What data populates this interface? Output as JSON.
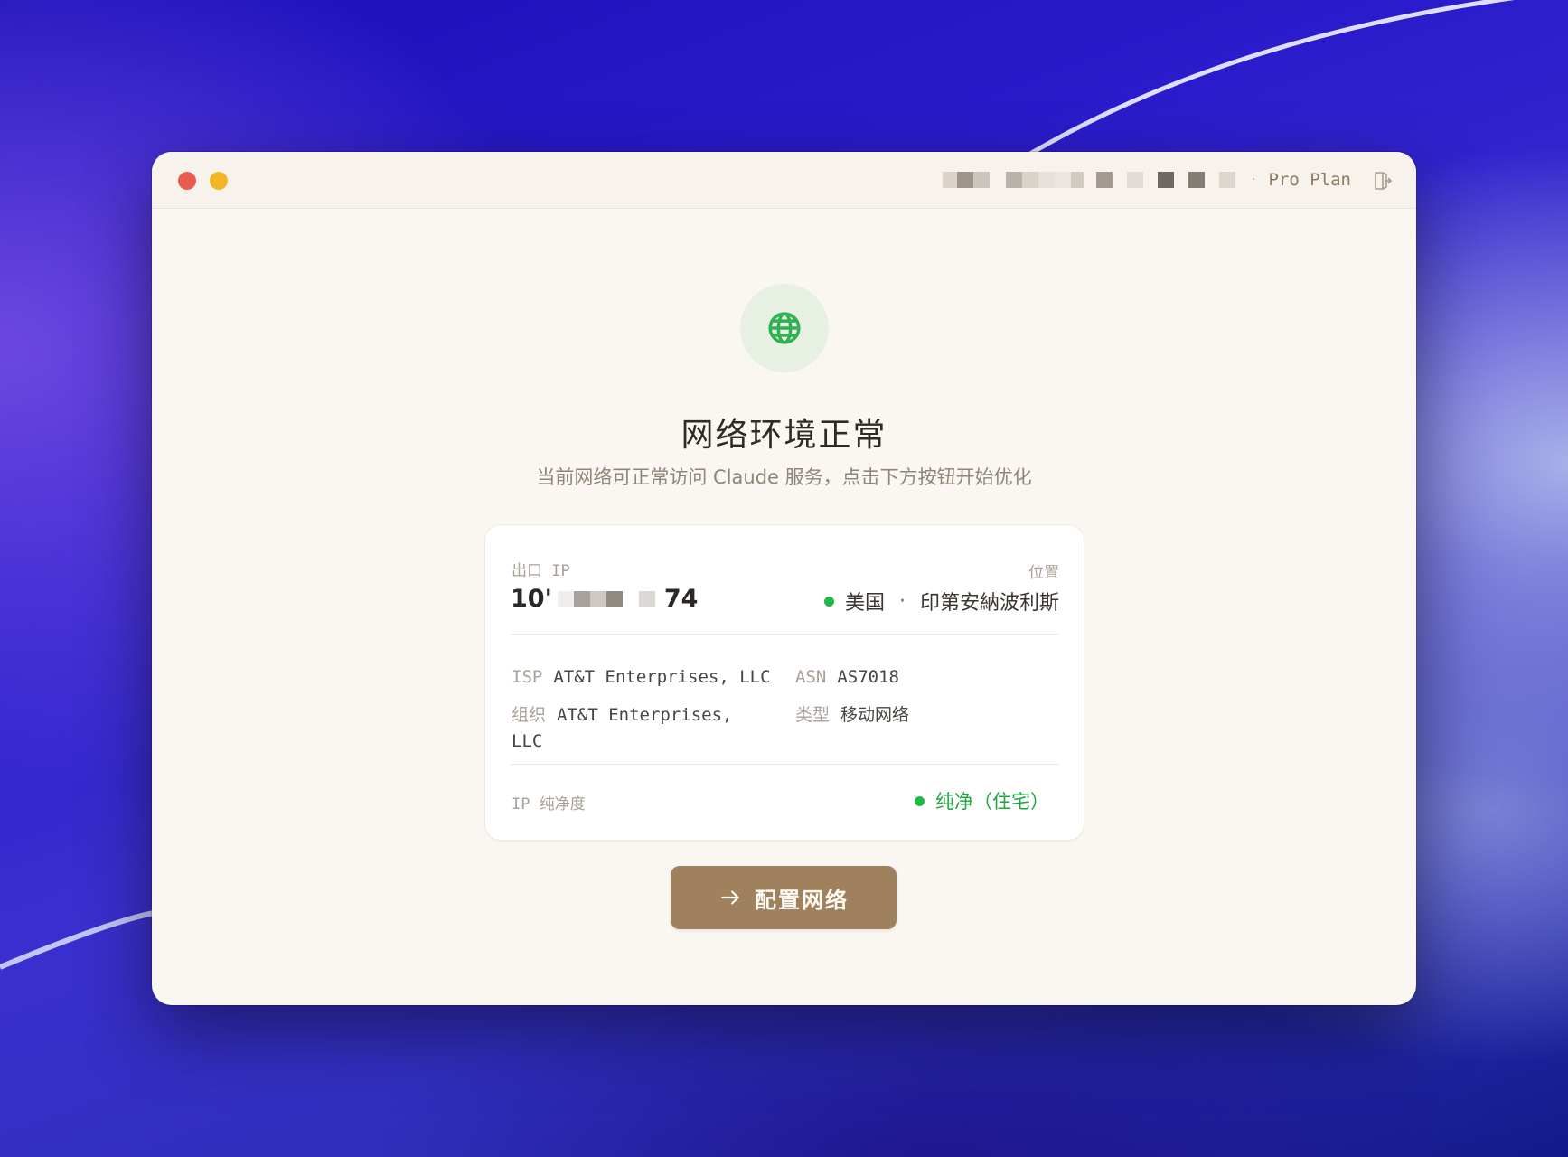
{
  "window": {
    "account": {
      "plan": "Pro Plan",
      "separator": "·"
    }
  },
  "status": {
    "icon": "globe-icon",
    "title": "网络环境正常",
    "subtitle": "当前网络可正常访问 Claude 服务，点击下方按钮开始优化"
  },
  "card": {
    "ip_label": "出口 IP",
    "ip_prefix": "10'",
    "ip_suffix": "74",
    "location_label": "位置",
    "country": "美国",
    "location_separator": "·",
    "city": "印第安納波利斯",
    "isp_label": "ISP",
    "isp_value": "AT&T Enterprises, LLC",
    "asn_label": "ASN",
    "asn_value": "AS7018",
    "org_label": "组织",
    "org_value_line1": "AT&T Enterprises,",
    "org_value_line2": "LLC",
    "type_label": "类型",
    "type_value": "移动网络",
    "purity_label": "IP 纯净度",
    "purity_value": "纯净（住宅）"
  },
  "action": {
    "label": "配置网络"
  },
  "colors": {
    "accent": "#a0815e",
    "success": "#22b847",
    "window_bg": "#faf6f1"
  }
}
